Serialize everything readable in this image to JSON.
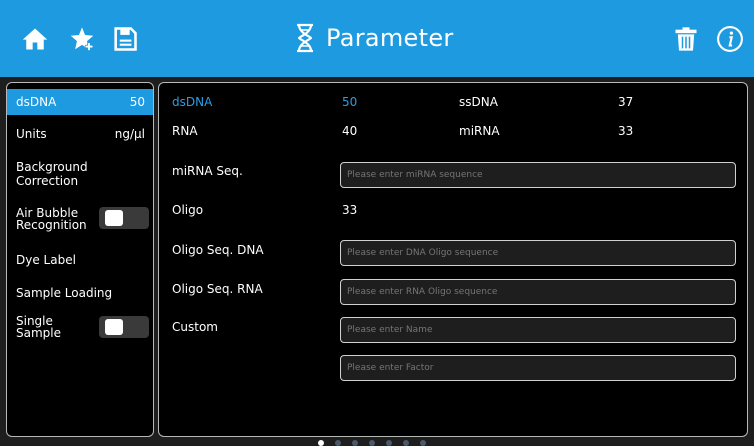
{
  "header": {
    "title": "Parameter",
    "icons": [
      "home-icon",
      "star-icon",
      "save-icon",
      "dna-icon",
      "trash-icon",
      "info-icon"
    ],
    "color": "#1e9ae0"
  },
  "sidebar": {
    "items": [
      {
        "label": "dsDNA",
        "value": "50",
        "active": true
      },
      {
        "label": "Units",
        "value": "ng/µl"
      },
      {
        "label": "Background\nCorrection"
      },
      {
        "label": "Air Bubble\nRecognition",
        "toggle": false
      },
      {
        "label": "Dye Label"
      },
      {
        "label": "Sample Loading"
      },
      {
        "label": "Single\nSample",
        "toggle": false
      }
    ]
  },
  "main": {
    "rows": {
      "dsdna_label": "dsDNA",
      "dsdna_value": "50",
      "ssdna_label": "ssDNA",
      "ssdna_value": "37",
      "rna_label": "RNA",
      "rna_value": "40",
      "mirna_label": "miRNA",
      "mirna_value": "33",
      "mirna_seq_label": "miRNA Seq.",
      "oligo_label": "Oligo",
      "oligo_value": "33",
      "oligo_seq_dna_label": "Oligo Seq. DNA",
      "oligo_seq_rna_label": "Oligo Seq. RNA",
      "custom_label": "Custom"
    },
    "fields": {
      "mirna_seq_placeholder": "Please enter miRNA sequence",
      "oligo_dna_placeholder": "Please enter DNA Oligo sequence",
      "oligo_rna_placeholder": "Please enter RNA Oligo sequence",
      "custom_name_placeholder": "Please enter Name",
      "custom_factor_placeholder": "Please enter Factor"
    }
  },
  "pager": {
    "count": 7,
    "active": 0
  }
}
